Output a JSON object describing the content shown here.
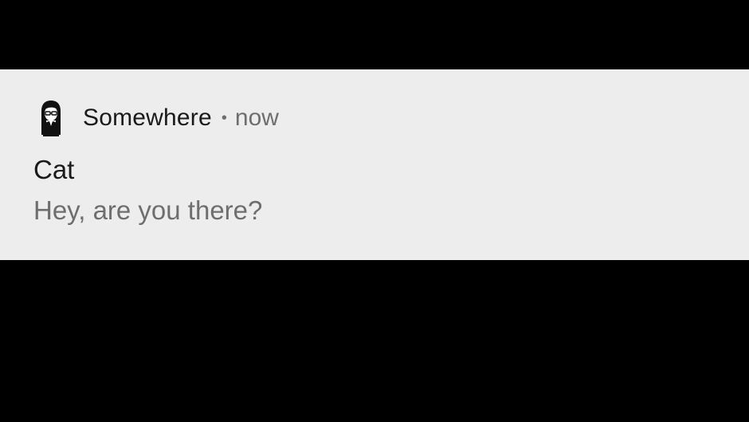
{
  "notification": {
    "app_icon": "woman-avatar-icon",
    "app_name": "Somewhere",
    "separator": "•",
    "time": "now",
    "title": "Cat",
    "message": "Hey, are you there?"
  },
  "colors": {
    "screen_background": "#000000",
    "notification_background": "#ededed",
    "primary_text": "#1a1a1a",
    "secondary_text": "#6e6e6e"
  }
}
